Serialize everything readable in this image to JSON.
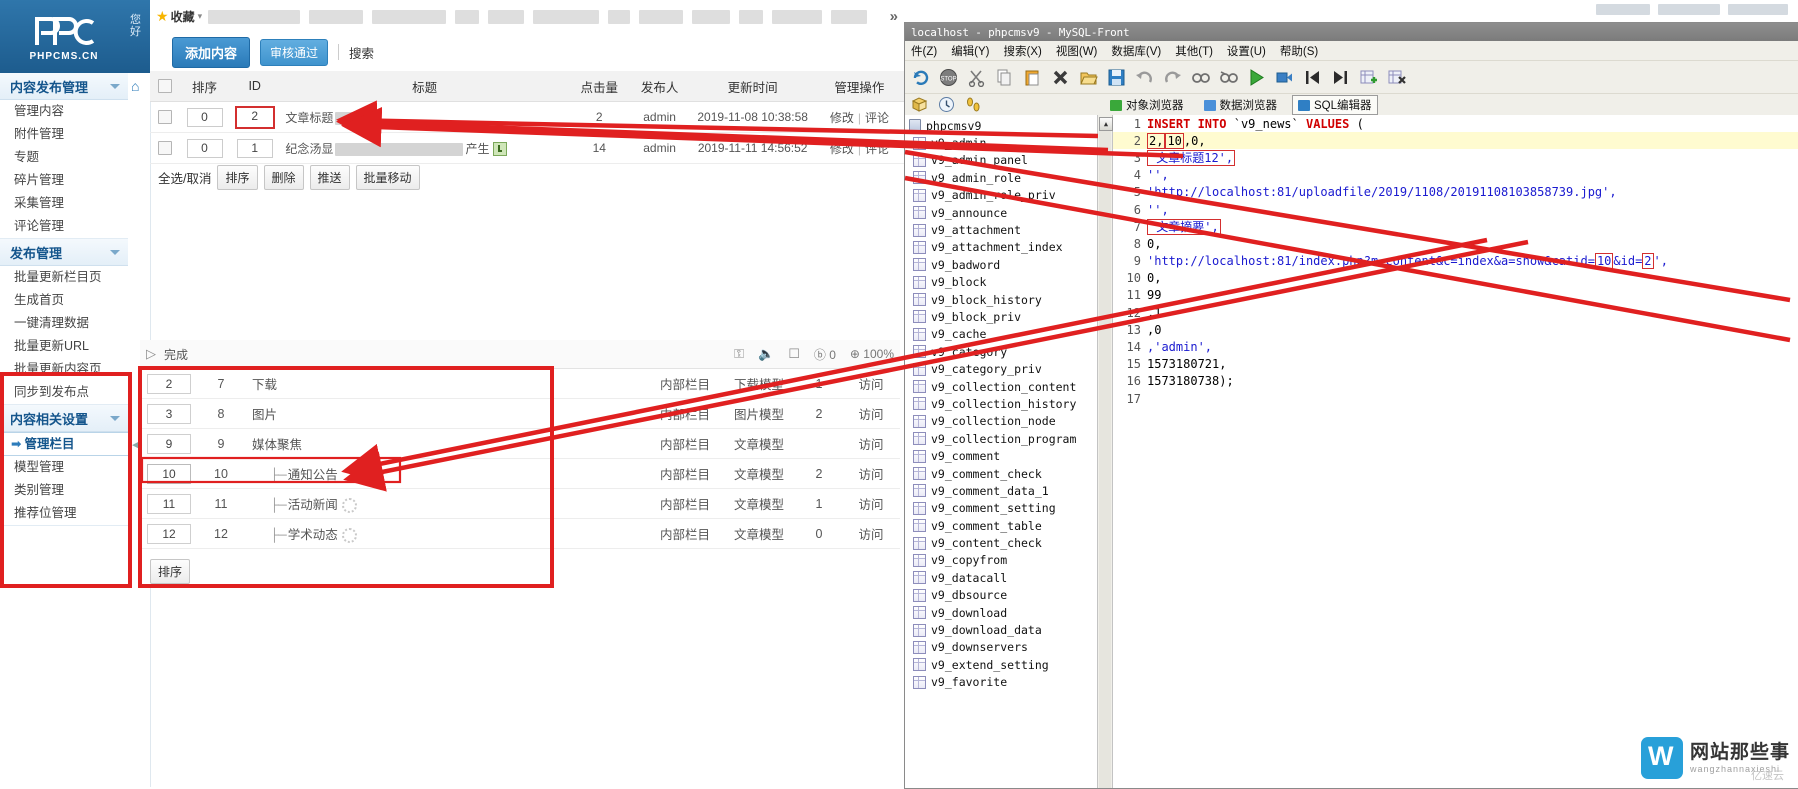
{
  "app": {
    "logo_text": "PHPCMS.CN",
    "greeting": "您好"
  },
  "sidebar": {
    "groups": [
      {
        "title": "内容发布管理",
        "items": [
          {
            "label": "管理内容",
            "active": false
          },
          {
            "label": "附件管理",
            "active": false
          },
          {
            "label": "专题",
            "active": false
          },
          {
            "label": "碎片管理",
            "active": false
          },
          {
            "label": "采集管理",
            "active": false
          },
          {
            "label": "评论管理",
            "active": false
          }
        ]
      },
      {
        "title": "发布管理",
        "items": [
          {
            "label": "批量更新栏目页",
            "active": false
          },
          {
            "label": "生成首页",
            "active": false
          },
          {
            "label": "一键清理数据",
            "active": false
          },
          {
            "label": "批量更新URL",
            "active": false
          },
          {
            "label": "批量更新内容页",
            "active": false
          },
          {
            "label": "同步到发布点",
            "active": false
          }
        ]
      },
      {
        "title": "内容相关设置",
        "items": [
          {
            "label": "管理栏目",
            "active": true,
            "arrow": "➡"
          },
          {
            "label": "模型管理",
            "active": false
          },
          {
            "label": "类别管理",
            "active": false
          },
          {
            "label": "推荐位管理",
            "active": false
          }
        ]
      }
    ]
  },
  "favbar": {
    "star_icon": "star-icon",
    "label": "收藏",
    "caret": "▾",
    "more_icon": "»",
    "chip_widths": [
      92,
      54,
      74,
      24,
      36,
      66,
      22,
      44,
      38,
      24,
      50,
      36
    ]
  },
  "toolbar": {
    "add_content": "添加内容",
    "approved": "审核通过",
    "search": "搜索"
  },
  "content_table": {
    "headers": [
      "",
      "排序",
      "ID",
      "标题",
      "点击量",
      "发布人",
      "更新时间",
      "管理操作"
    ],
    "rows": [
      {
        "order": "0",
        "id": "2",
        "id_highlight": true,
        "title": "文章标题",
        "hits": "2",
        "author": "admin",
        "updated": "2019-11-08 10:38:58",
        "ops": [
          "修改",
          "评论"
        ]
      },
      {
        "order": "0",
        "id": "1",
        "id_highlight": false,
        "title_prefix": "纪念汤显",
        "title_suffix": "产生",
        "has_attachment_icon": true,
        "hits": "14",
        "author": "admin",
        "updated": "2019-11-11 14:56:52",
        "ops": [
          "修改",
          "评论"
        ]
      }
    ],
    "batch_actions": {
      "select_label": "全选/取消",
      "buttons": [
        "排序",
        "删除",
        "推送",
        "批量移动"
      ]
    }
  },
  "player_bar": {
    "play_icon": "play-icon",
    "status": "完成",
    "shield_icon": "shield-icon",
    "sound_icon": "sound-icon",
    "box_icon": "box-icon",
    "hd_label": "0",
    "zoom_icon": "zoom-in-icon",
    "zoom_level": "100%"
  },
  "column_table": {
    "rows": [
      {
        "order": "2",
        "id": "7",
        "name": "下载",
        "indent": 0,
        "type": "内部栏目",
        "model": "下载模型",
        "count": "1",
        "visit": "访问",
        "highlight": false,
        "gear": false
      },
      {
        "order": "3",
        "id": "8",
        "name": "图片",
        "indent": 0,
        "type": "内部栏目",
        "model": "图片模型",
        "count": "2",
        "visit": "访问",
        "highlight": false,
        "gear": false
      },
      {
        "order": "9",
        "id": "9",
        "name": "媒体聚焦",
        "indent": 0,
        "type": "内部栏目",
        "model": "文章模型",
        "count": "",
        "visit": "访问",
        "highlight": false,
        "gear": false
      },
      {
        "order": "10",
        "id": "10",
        "name": "通知公告",
        "indent": 1,
        "type": "内部栏目",
        "model": "文章模型",
        "count": "2",
        "visit": "访问",
        "highlight": true,
        "gear": false
      },
      {
        "order": "11",
        "id": "11",
        "name": "活动新闻",
        "indent": 1,
        "type": "内部栏目",
        "model": "文章模型",
        "count": "1",
        "visit": "访问",
        "highlight": false,
        "gear": true
      },
      {
        "order": "12",
        "id": "12",
        "name": "学术动态",
        "indent": 1,
        "type": "内部栏目",
        "model": "文章模型",
        "count": "0",
        "visit": "访问",
        "highlight": false,
        "gear": true
      }
    ],
    "sort_button": "排序",
    "tree_prefix": "├─"
  },
  "mysql_front": {
    "title": "localhost - phpcmsv9 - MySQL-Front",
    "menu": [
      "件(Z)",
      "编辑(Y)",
      "搜索(X)",
      "视图(W)",
      "数据库(V)",
      "其他(T)",
      "设置(U)",
      "帮助(S)"
    ],
    "tabs": [
      {
        "label": "对象浏览器",
        "selected": false,
        "icon": "object-browser-icon"
      },
      {
        "label": "数据浏览器",
        "selected": false,
        "icon": "data-browser-icon"
      },
      {
        "label": "SQL编辑器",
        "selected": true,
        "icon": "sql-editor-icon"
      }
    ],
    "database": "phpcmsv9",
    "tables": [
      "v9_admin",
      "v9_admin_panel",
      "v9_admin_role",
      "v9_admin_role_priv",
      "v9_announce",
      "v9_attachment",
      "v9_attachment_index",
      "v9_badword",
      "v9_block",
      "v9_block_history",
      "v9_block_priv",
      "v9_cache",
      "v9_category",
      "v9_category_priv",
      "v9_collection_content",
      "v9_collection_history",
      "v9_collection_node",
      "v9_collection_program",
      "v9_comment",
      "v9_comment_check",
      "v9_comment_data_1",
      "v9_comment_setting",
      "v9_comment_table",
      "v9_content_check",
      "v9_copyfrom",
      "v9_datacall",
      "v9_dbsource",
      "v9_download",
      "v9_download_data",
      "v9_downservers",
      "v9_extend_setting",
      "v9_favorite"
    ],
    "sql_lines": [
      {
        "n": "1",
        "text": "INSERT INTO `v9_news` VALUES (",
        "kind": "stmt",
        "hl": false
      },
      {
        "n": "2",
        "text": "2,10,0,",
        "kind": "boxed2",
        "hl": true
      },
      {
        "n": "3",
        "text": "'文章标题12',",
        "kind": "boxed-str",
        "hl": false
      },
      {
        "n": "4",
        "text": "'',",
        "kind": "str",
        "hl": false
      },
      {
        "n": "5",
        "text": "'http://localhost:81/uploadfile/2019/1108/20191108103858739.jpg',",
        "kind": "str",
        "hl": false
      },
      {
        "n": "6",
        "text": "'',",
        "kind": "str",
        "hl": false
      },
      {
        "n": "7",
        "text": "'文章摘要',",
        "kind": "boxed-str",
        "hl": false
      },
      {
        "n": "8",
        "text": "0,",
        "kind": "num",
        "hl": false
      },
      {
        "n": "9",
        "text": "'http://localhost:81/index.php?m=content&c=index&a=show&catid=10&id=2',",
        "kind": "str-boxed-tail",
        "hl": false
      },
      {
        "n": "10",
        "text": "0,",
        "kind": "num",
        "hl": false
      },
      {
        "n": "11",
        "text": "99",
        "kind": "num",
        "hl": false
      },
      {
        "n": "12",
        "text": ",1",
        "kind": "num",
        "hl": false
      },
      {
        "n": "13",
        "text": ",0",
        "kind": "num",
        "hl": false
      },
      {
        "n": "14",
        "text": ",'admin',",
        "kind": "str",
        "hl": false
      },
      {
        "n": "15",
        "text": "1573180721,",
        "kind": "num",
        "hl": false
      },
      {
        "n": "16",
        "text": "1573180738);",
        "kind": "num",
        "hl": false
      },
      {
        "n": "17",
        "text": "",
        "kind": "blank",
        "hl": false
      }
    ]
  },
  "watermark": {
    "title": "网站那些事",
    "subtitle": "wangzhannaxieshi",
    "credit": "亿速云"
  },
  "colors": {
    "accent": "#2a7ab8",
    "annotation": "#e02020",
    "header_bg": "#2f76ab",
    "highlight_row": "#fffbd0"
  }
}
